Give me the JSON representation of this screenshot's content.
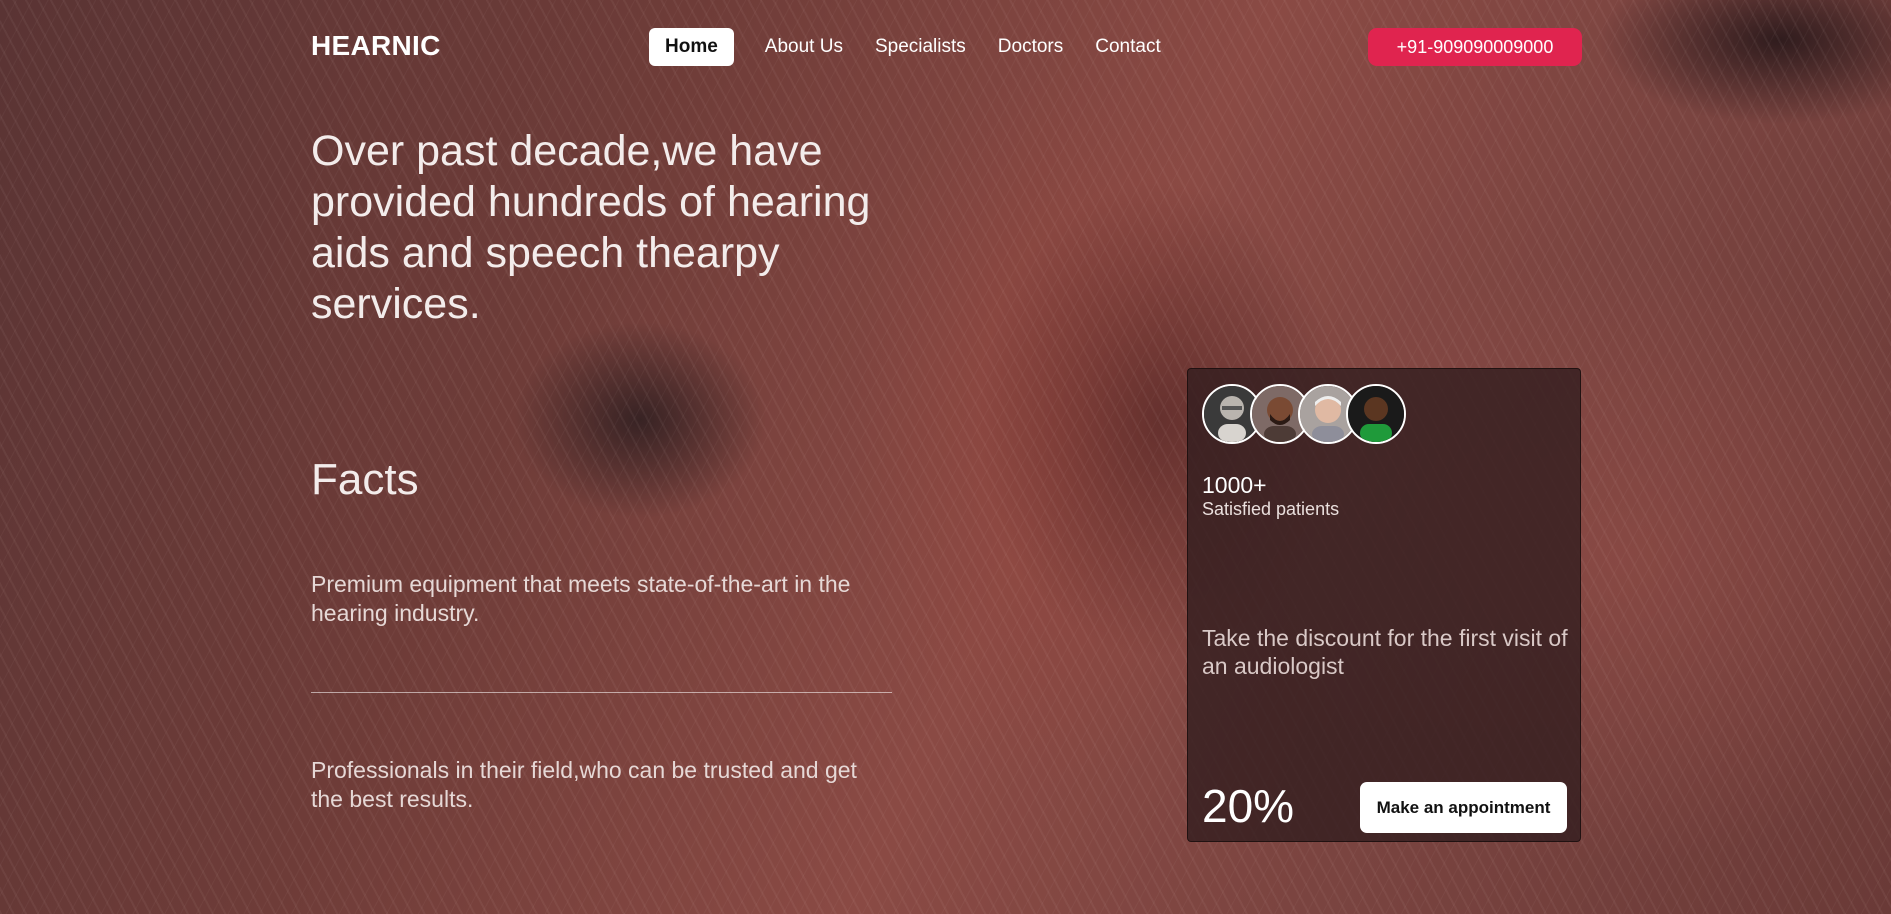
{
  "header": {
    "logo": "HEARNIC",
    "nav": [
      {
        "label": "Home",
        "active": true
      },
      {
        "label": "About Us",
        "active": false
      },
      {
        "label": "Specialists",
        "active": false
      },
      {
        "label": "Doctors",
        "active": false
      },
      {
        "label": "Contact",
        "active": false
      }
    ],
    "phone": "+91-909090009000"
  },
  "hero": {
    "title": "Over past decade,we have provided hundreds of hearing aids and speech thearpy services."
  },
  "facts": {
    "title": "Facts",
    "items": [
      "Premium equipment that meets state-of-the-art in the hearing industry.",
      "Professionals in their field,who can be trusted and get the best results."
    ]
  },
  "card": {
    "avatars": [
      "avatar-elderly-man",
      "avatar-smiling-bearded-man",
      "avatar-older-man",
      "avatar-man-green-shirt"
    ],
    "count": "1000+",
    "count_label": "Satisfied patients",
    "discount_text": "Take the discount for the first visit of an audiologist",
    "percent": "20%",
    "button_label": "Make an appointment"
  },
  "colors": {
    "accent": "#e0244f",
    "card_bg": "#341e20",
    "text": "#ffffff"
  }
}
